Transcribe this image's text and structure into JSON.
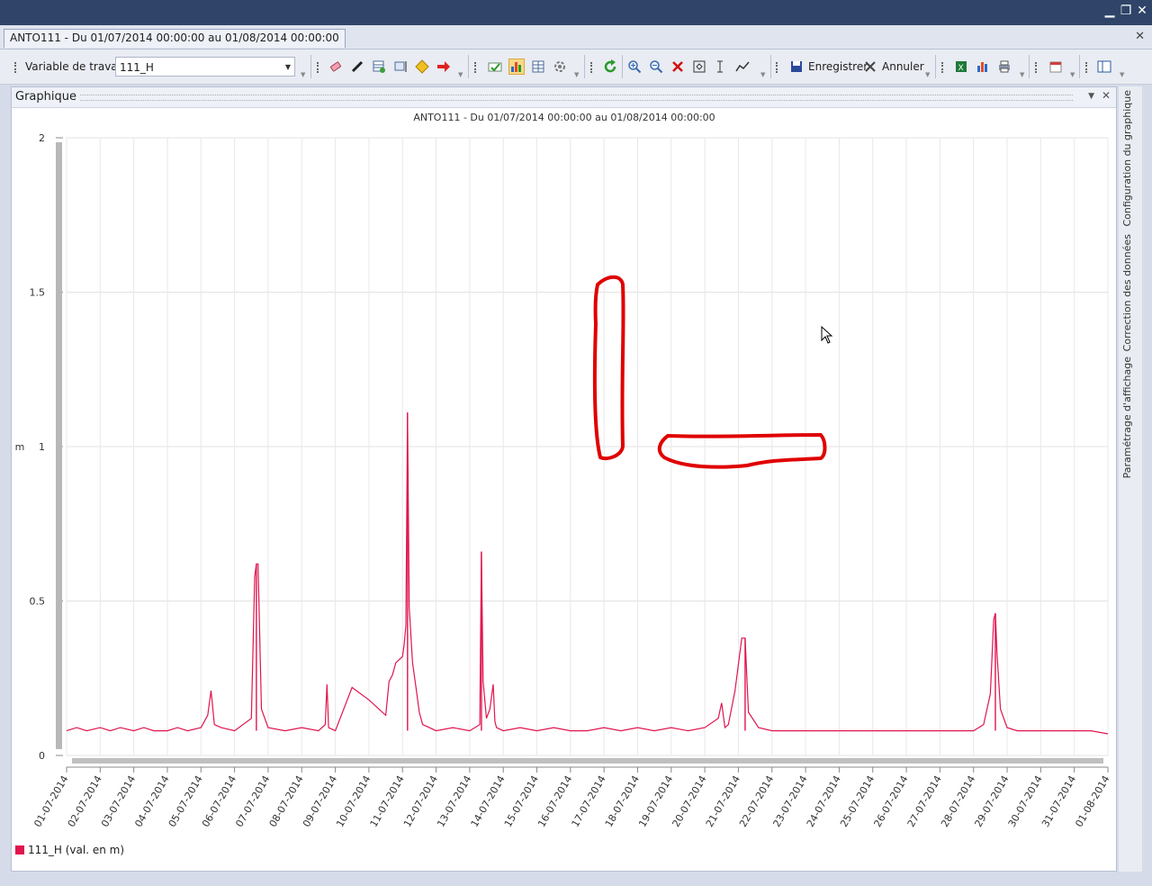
{
  "window": {
    "doc_tab_title": "ANTO111 - Du 01/07/2014 00:00:00 au 01/08/2014 00:00:00"
  },
  "toolbar": {
    "variable_label": "Variable de travail:",
    "variable_value": "111_H",
    "save_label": "Enregistrer",
    "cancel_label": "Annuler"
  },
  "panel": {
    "title": "Graphique"
  },
  "sidebar": {
    "tabs": [
      "Configuration du graphique",
      "Correction des données",
      "Paramétrage d'affichage"
    ]
  },
  "legend": {
    "label": "111_H (val. en m)"
  },
  "colors": {
    "series": "#e0154e",
    "annotation": "#e00000",
    "titlebar": "#2f4468"
  },
  "chart_data": {
    "type": "line",
    "title": "ANTO111 - Du 01/07/2014 00:00:00 au 01/08/2014 00:00:00",
    "ylabel": "m",
    "xlabel": "",
    "ylim": [
      0,
      2
    ],
    "y_ticks": [
      "0",
      "0.5",
      "1",
      "1.5",
      "2"
    ],
    "x_ticks": [
      "01-07-2014",
      "02-07-2014",
      "03-07-2014",
      "04-07-2014",
      "05-07-2014",
      "06-07-2014",
      "07-07-2014",
      "08-07-2014",
      "09-07-2014",
      "10-07-2014",
      "11-07-2014",
      "12-07-2014",
      "13-07-2014",
      "14-07-2014",
      "15-07-2014",
      "16-07-2014",
      "17-07-2014",
      "18-07-2014",
      "19-07-2014",
      "20-07-2014",
      "21-07-2014",
      "22-07-2014",
      "23-07-2014",
      "24-07-2014",
      "25-07-2014",
      "26-07-2014",
      "27-07-2014",
      "28-07-2014",
      "29-07-2014",
      "30-07-2014",
      "31-07-2014",
      "01-08-2014"
    ],
    "grid": true,
    "legend_position": "bottom-left",
    "series": [
      {
        "name": "111_H (val. en m)",
        "x_days": [
          0,
          0.3,
          0.6,
          1,
          1.3,
          1.6,
          2,
          2.3,
          2.6,
          3,
          3.3,
          3.6,
          4,
          4.2,
          4.3,
          4.4,
          4.6,
          5,
          5.5,
          5.6,
          5.7,
          5.8,
          6,
          6.5,
          7,
          7.5,
          7.7,
          7.75,
          7.8,
          8,
          8.5,
          9,
          9.5,
          9.6,
          9.7,
          9.8,
          10,
          10.05,
          10.1,
          10.2,
          10.3,
          10.4,
          10.5,
          10.6,
          10.8,
          11,
          11.5,
          12,
          12.3,
          12.35,
          12.4,
          12.5,
          12.6,
          12.7,
          12.75,
          12.8,
          13,
          13.5,
          14,
          14.5,
          15,
          15.5,
          16,
          16.5,
          17,
          17.5,
          18,
          18.5,
          19,
          19.4,
          19.5,
          19.6,
          19.7,
          19.9,
          20.1,
          20.3,
          20.6,
          21,
          21.5,
          22,
          22.5,
          23,
          23.5,
          24,
          24.5,
          25,
          25.5,
          26,
          26.5,
          27,
          27.3,
          27.5,
          27.6,
          27.65,
          27.7,
          27.8,
          28,
          28.3,
          28.6,
          29,
          29.5,
          30,
          30.5,
          31
        ],
        "values": [
          0.08,
          0.09,
          0.08,
          0.09,
          0.08,
          0.09,
          0.08,
          0.09,
          0.08,
          0.08,
          0.09,
          0.08,
          0.09,
          0.13,
          0.21,
          0.1,
          0.09,
          0.08,
          0.12,
          0.58,
          0.62,
          0.15,
          0.09,
          0.08,
          0.09,
          0.08,
          0.1,
          0.23,
          0.09,
          0.08,
          0.22,
          0.18,
          0.13,
          0.24,
          0.26,
          0.3,
          0.32,
          0.36,
          0.42,
          0.48,
          0.3,
          0.22,
          0.14,
          0.1,
          0.09,
          0.08,
          0.09,
          0.08,
          0.1,
          0.66,
          0.24,
          0.12,
          0.15,
          0.23,
          0.11,
          0.09,
          0.08,
          0.09,
          0.08,
          0.09,
          0.08,
          0.08,
          0.09,
          0.08,
          0.09,
          0.08,
          0.09,
          0.08,
          0.09,
          0.12,
          0.17,
          0.09,
          0.1,
          0.21,
          0.38,
          0.14,
          0.09,
          0.08,
          0.08,
          0.08,
          0.08,
          0.08,
          0.08,
          0.08,
          0.08,
          0.08,
          0.08,
          0.08,
          0.08,
          0.08,
          0.1,
          0.2,
          0.44,
          0.46,
          0.33,
          0.15,
          0.09,
          0.08,
          0.08,
          0.08,
          0.08,
          0.08,
          0.08,
          0.07
        ],
        "peaks": [
          {
            "day": 10.15,
            "value": 1.11
          },
          {
            "day": 12.35,
            "value": 0.66
          },
          {
            "day": 5.65,
            "value": 0.62
          },
          {
            "day": 20.2,
            "value": 0.38
          },
          {
            "day": 27.65,
            "value": 0.46
          }
        ]
      }
    ]
  }
}
